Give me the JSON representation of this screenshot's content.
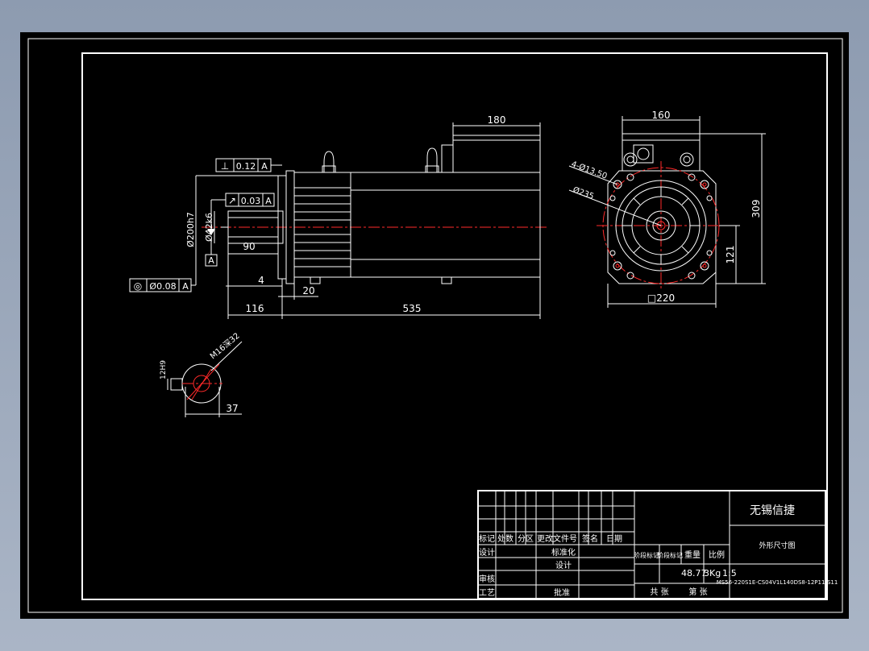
{
  "dimensions": {
    "motor_body_length": "535",
    "shaft_length": "116",
    "shoulder": "20",
    "flange_thickness": "4",
    "key_length": "90",
    "junction_box_length": "180",
    "junction_box_width": "160",
    "mount_holes": "4-Ø13.50",
    "pitch_circle": "Ø235",
    "pilot_diameter": "Ø200h7",
    "shaft_diameter": "Ø42k6",
    "frame_square": "□220",
    "total_height": "309",
    "center_height": "121",
    "key_height": "37",
    "key_width": "12H9",
    "thread": "M16深32"
  },
  "tolerances": {
    "perpendicularity": {
      "symbol": "⊥",
      "value": "0.12",
      "datum": "A"
    },
    "runout": {
      "symbol": "↗",
      "value": "0.03",
      "datum": "A"
    },
    "concentricity": {
      "symbol": "◎",
      "value": "Ø0.08",
      "datum": "A"
    },
    "datum_label": "A"
  },
  "title_block": {
    "company": "无锡信捷",
    "drawing_title": "外形尺寸图",
    "part_number": "MS56-220S1E-CS04V1L140DS8-12P11-S11",
    "weight": "48.77",
    "unit": "3Kg",
    "scale": "1:5",
    "header_labels": [
      "标记",
      "处数",
      "分区",
      "更改文件号",
      "签名",
      "日期"
    ],
    "design": "设计",
    "standardization": "标准化",
    "review": "审核",
    "process": "工艺",
    "approve": "批准",
    "stage_mark": "阶段标记",
    "weight_label": "重量",
    "scale_label": "比例",
    "sheet_total": "共 张",
    "sheet_no": "第 张"
  }
}
